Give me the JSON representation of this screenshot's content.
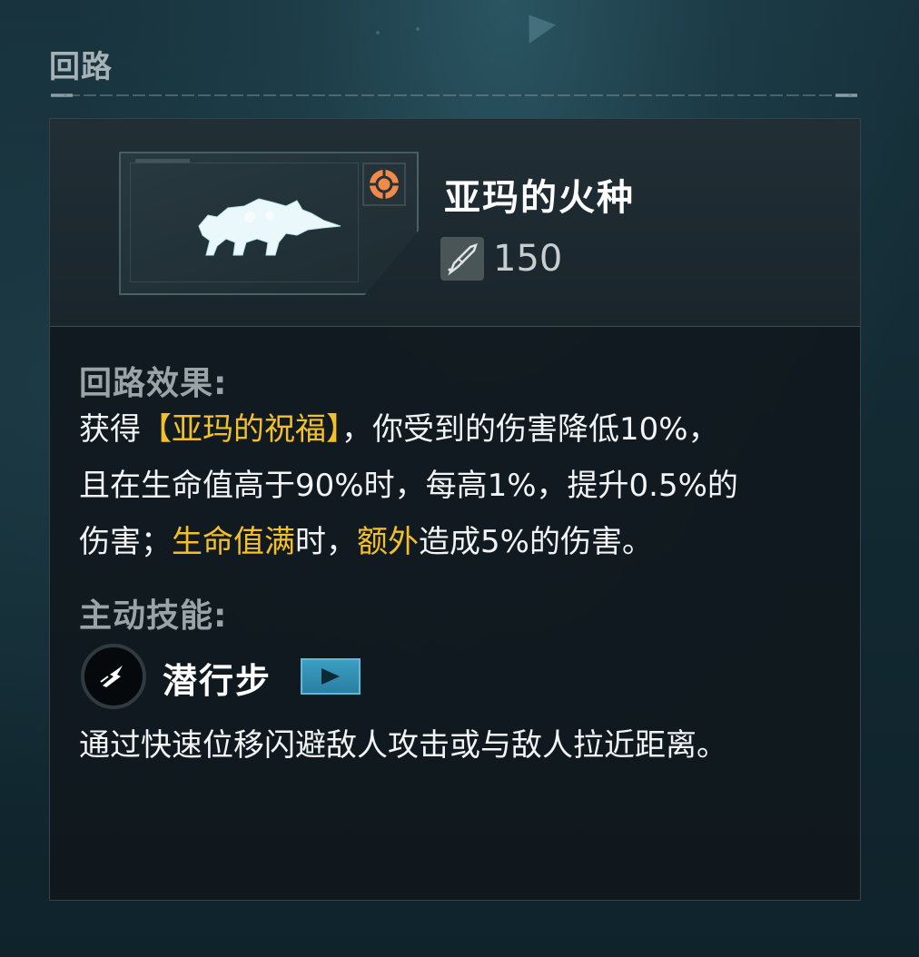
{
  "section": {
    "title": "回路"
  },
  "item": {
    "name": "亚玛的火种",
    "cost": "150",
    "element_icon": "orange-crosshair-icon",
    "cost_icon": "cost-blade-icon",
    "portrait": "beast-silhouette"
  },
  "effect": {
    "label": "回路效果:",
    "line1": {
      "t1": "获得",
      "h1": "【亚玛的祝福】",
      "t2": "，你受到的伤害降低10%，"
    },
    "line2": "且在生命值高于90%时，每高1%，提升0.5%的",
    "line3": {
      "t1": "伤害；",
      "h1": "生命值满",
      "t2": "时，",
      "h2": "额外",
      "t3": "造成5%的伤害。"
    }
  },
  "active": {
    "label": "主动技能:",
    "skill_name": "潜行步",
    "skill_icon": "dash-icon",
    "description": "通过快速位移闪避敌人攻击或与敌人拉近距离。"
  },
  "colors": {
    "highlight": "#f2c02b",
    "accent_orange": "#f08a4b",
    "play_blue": "#3a9ec2"
  }
}
